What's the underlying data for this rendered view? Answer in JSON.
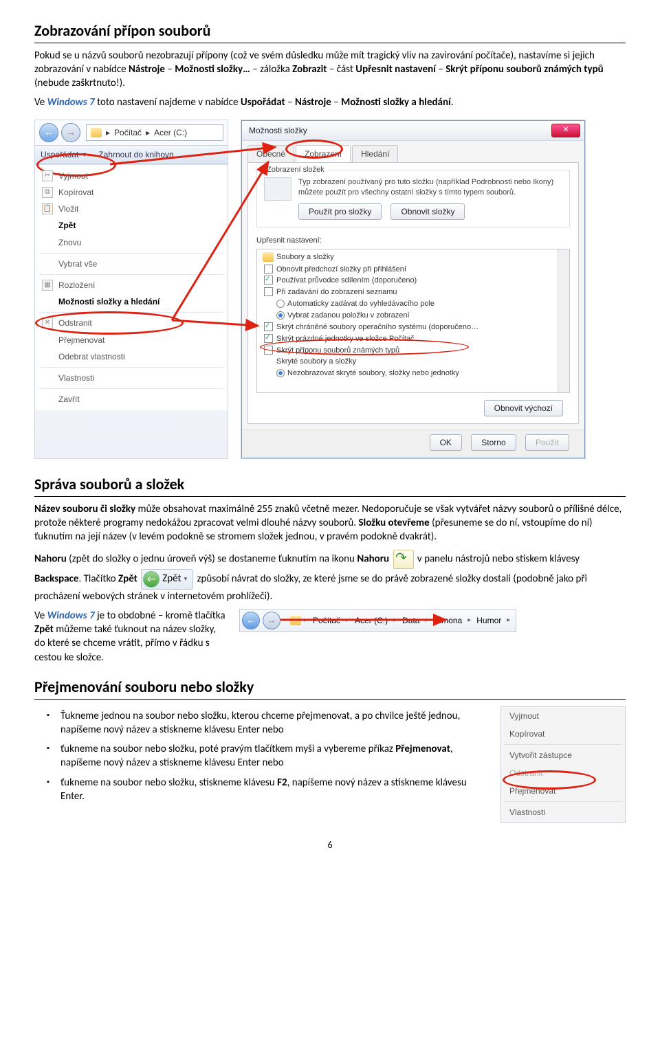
{
  "heading1": "Zobrazování přípon souborů",
  "p1_a": "Pokud se u názvů souborů nezobrazují přípony (což ve svém důsledku může mít tragický vliv na zavirování počítače), nastavíme si jejich zobrazování v nabídce ",
  "p1_b": "Nástroje",
  "p1_c": " – ",
  "p1_d": "Možnosti složky…",
  "p1_e": " – záložka ",
  "p1_f": "Zobrazit",
  "p1_g": " – část ",
  "p1_h": "Upřesnit nastavení",
  "p1_i": " – ",
  "p1_j": "Skrýt příponu souborů známých typů",
  "p1_k": " (nebude zaškrtnuto!).",
  "p2_a": "Ve ",
  "p2_b": "Windows 7",
  "p2_c": " toto nastavení najdeme v nabídce ",
  "p2_d": "Uspořádat",
  "p2_e": " – ",
  "p2_f": "Nástroje",
  "p2_g": " – ",
  "p2_h": "Možnosti složky a hledání",
  "p2_i": ".",
  "leftShot": {
    "addr": {
      "seg1": "Počítač",
      "seg2": "Acer (C:)"
    },
    "toolbar": {
      "organize": "Uspořádat",
      "include": "Zahrnout do knihovn"
    },
    "menu": {
      "cut": "Vyjmout",
      "copy": "Kopírovat",
      "paste": "Vložit",
      "undo": "Zpět",
      "redo": "Znovu",
      "selectAll": "Vybrat vše",
      "layout": "Rozložení",
      "folderOptions": "Možnosti složky a hledání",
      "delete": "Odstranit",
      "rename": "Přejmenovat",
      "removeProps": "Odebrat vlastnosti",
      "properties": "Vlastnosti",
      "close": "Zavřít"
    }
  },
  "dialog": {
    "title": "Možnosti složky",
    "tabs": {
      "general": "Obecné",
      "view": "Zobrazení",
      "search": "Hledání"
    },
    "group": {
      "label": "Zobrazení složek",
      "text": "Typ zobrazení používaný pro tuto složku (například Podrobnosti nebo Ikony) můžete použít pro všechny ostatní složky s tímto typem souborů.",
      "apply": "Použít pro složky",
      "reset": "Obnovit složky"
    },
    "advLabel": "Upřesnit nastavení:",
    "tree": {
      "root": "Soubory a složky",
      "i1": "Obnovit předchozí složky při přihlášení",
      "i2": "Používat průvodce sdílením (doporučeno)",
      "i3": "Při zadávání do zobrazení seznamu",
      "i3a": "Automaticky zadávat do vyhledávacího pole",
      "i3b": "Vybrat zadanou položku v zobrazení",
      "i4": "Skrýt chráněné soubory operačního systému (doporučeno…",
      "i5": "Skrýt prázdné jednotky ve složce Počítač",
      "i6": "Skrýt příponu souborů známých typů",
      "i7": "Skryté soubory a složky",
      "i7a": "Nezobrazovat skryté soubory, složky nebo jednotky"
    },
    "restoreDefaults": "Obnovit výchozí",
    "ok": "OK",
    "cancel": "Storno",
    "apply2": "Použít"
  },
  "heading2": "Správa souborů a složek",
  "p3_a": "Název souboru či složky",
  "p3_b": " může obsahovat maximálně 255 znaků včetně mezer. Nedoporučuje se však vytvářet názvy souborů o přílišné délce, protože některé programy nedokážou zpracovat velmi dlouhé názvy souborů. ",
  "p3_c": "Složku otevřeme",
  "p3_d": " (přesuneme se do ní, vstoupíme do ní) ťuknutím na její název (v levém podokně se stromem složek jednou, v pravém podokně dvakrát).",
  "p4_a": "Nahoru",
  "p4_b": " (zpět do složky o jednu úroveň výš) se dostaneme ťuknutím na ikonu ",
  "p4_c": "Nahoru",
  "p4_d": " v panelu nástrojů nebo stiskem klávesy ",
  "p4_e": "Backspace",
  "p4_f": ". Tlačítko ",
  "p4_g": "Zpět",
  "p4_h": " způsobí návrat do složky, ze které jsme se do právě zobrazené složky dostali (podobně jako při procházení webových stránek v internetovém prohlížeči).",
  "zpet_label": "Zpět",
  "p5_a": "Ve ",
  "p5_b": "Windows 7",
  "p5_c": " je to obdobné – kromě tlačítka ",
  "p5_d": "Zpět",
  "p5_e": " můžeme také ťuknout na název složky, do které se chceme vrátit, přímo v řádku s cestou ke složce.",
  "breadcrumb": {
    "seg1": "Počítač",
    "seg2": "Acer (C:)",
    "seg3": "Data",
    "seg4": "Simona",
    "seg5": "Humor"
  },
  "heading3": "Přejmenování souboru nebo složky",
  "bullets": {
    "b1_a": "Ťukneme jednou na soubor nebo složku, kterou chceme přejmenovat, a po chvilce ještě jednou, napíšeme nový název a stiskneme klávesu Enter nebo",
    "b2_a": "ťukneme na soubor nebo složku, poté pravým tlačítkem myši a vybereme příkaz ",
    "b2_b": "Přejmenovat",
    "b2_c": ", napíšeme nový název a stiskneme klávesu Enter nebo",
    "b3_a": "ťukneme na soubor nebo složku, stiskneme klávesu ",
    "b3_b": "F2",
    "b3_c": ", napíšeme nový název a stiskneme klávesu Enter."
  },
  "ctxMenu": {
    "cut": "Vyjmout",
    "copy": "Kopírovat",
    "shortcut": "Vytvořit zástupce",
    "delete": "Odstranit",
    "rename": "Přejmenovat",
    "properties": "Vlastnosti"
  },
  "pageNum": "6"
}
